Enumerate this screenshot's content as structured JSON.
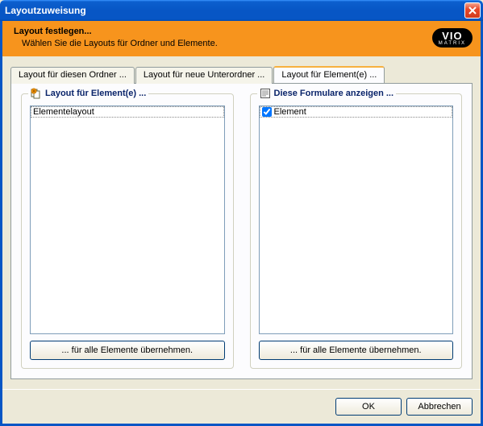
{
  "window": {
    "title": "Layoutzuweisung"
  },
  "header": {
    "title": "Layout festlegen...",
    "subtitle": "Wählen Sie die Layouts für Ordner und Elemente.",
    "logo_top": "VIO",
    "logo_bottom": "MATRIX"
  },
  "tabs": [
    {
      "label": "Layout für diesen Ordner ...",
      "active": false
    },
    {
      "label": "Layout für neue Unterordner ...",
      "active": false
    },
    {
      "label": "Layout für Element(e) ...",
      "active": true
    }
  ],
  "panel": {
    "left": {
      "legend": "Layout für Element(e) ...",
      "items": [
        {
          "text": "Elementelayout"
        }
      ],
      "button": "... für alle Elemente übernehmen."
    },
    "right": {
      "legend": "Diese Formulare anzeigen ...",
      "items": [
        {
          "text": "Element",
          "checked": true
        }
      ],
      "button": "... für alle Elemente übernehmen."
    }
  },
  "footer": {
    "ok": "OK",
    "cancel": "Abbrechen"
  }
}
